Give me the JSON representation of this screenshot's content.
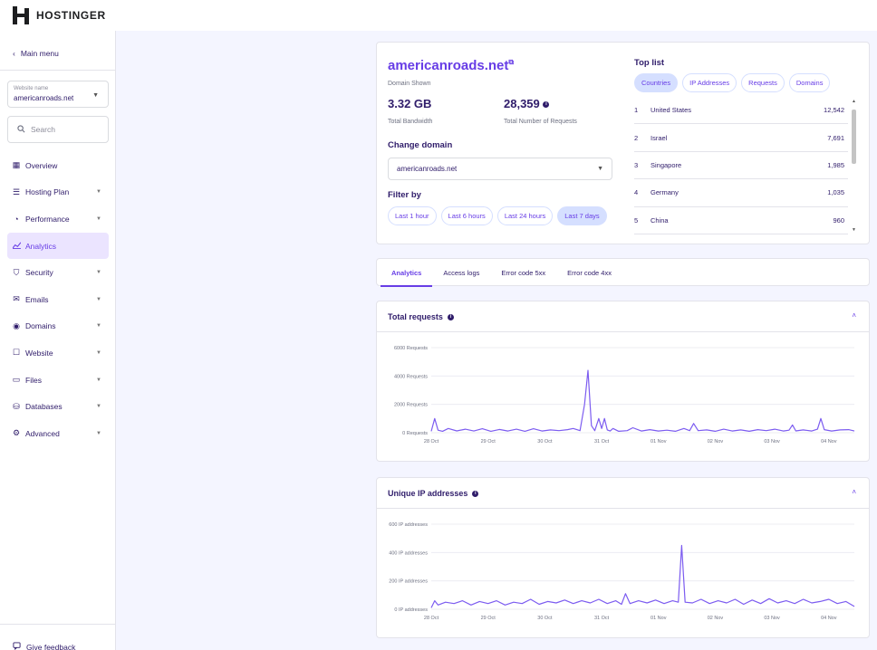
{
  "brand": {
    "name": "HOSTINGER"
  },
  "sidebar": {
    "back_label": "Main menu",
    "website_label": "Website name",
    "website_value": "americanroads.net",
    "search_placeholder": "Search",
    "items": [
      {
        "label": "Overview",
        "icon": "grid-icon",
        "expandable": false
      },
      {
        "label": "Hosting Plan",
        "icon": "server-icon",
        "expandable": true
      },
      {
        "label": "Performance",
        "icon": "gauge-icon",
        "expandable": true
      },
      {
        "label": "Analytics",
        "icon": "chart-line-icon",
        "expandable": false,
        "active": true
      },
      {
        "label": "Security",
        "icon": "shield-icon",
        "expandable": true
      },
      {
        "label": "Emails",
        "icon": "mail-icon",
        "expandable": true
      },
      {
        "label": "Domains",
        "icon": "globe-icon",
        "expandable": true
      },
      {
        "label": "Website",
        "icon": "browser-icon",
        "expandable": true
      },
      {
        "label": "Files",
        "icon": "folder-icon",
        "expandable": true
      },
      {
        "label": "Databases",
        "icon": "database-icon",
        "expandable": true
      },
      {
        "label": "Advanced",
        "icon": "gear-icon",
        "expandable": true
      }
    ],
    "feedback_label": "Give feedback"
  },
  "domain_card": {
    "domain": "americanroads.net",
    "domain_caption": "Domain Shown",
    "bandwidth": "3.32 GB",
    "bandwidth_label": "Total Bandwidth",
    "requests": "28,359",
    "requests_label": "Total Number of Requests",
    "change_domain_label": "Change domain",
    "change_domain_value": "americanroads.net",
    "filter_label": "Filter by",
    "filters": [
      "Last 1 hour",
      "Last 6 hours",
      "Last 24 hours",
      "Last 7 days"
    ],
    "active_filter": 3
  },
  "top_list": {
    "title": "Top list",
    "tabs": [
      "Countries",
      "IP Addresses",
      "Requests",
      "Domains"
    ],
    "active_tab": 0,
    "rows": [
      {
        "rank": "1",
        "name": "United States",
        "count": "12,542"
      },
      {
        "rank": "2",
        "name": "Israel",
        "count": "7,691"
      },
      {
        "rank": "3",
        "name": "Singapore",
        "count": "1,985"
      },
      {
        "rank": "4",
        "name": "Germany",
        "count": "1,035"
      },
      {
        "rank": "5",
        "name": "China",
        "count": "960"
      }
    ]
  },
  "analytics_tabs": {
    "tabs": [
      "Analytics",
      "Access logs",
      "Error code 5xx",
      "Error code 4xx"
    ],
    "active": 0
  },
  "colors": {
    "accent": "#673de6",
    "accent_light": "#d5dfff",
    "text": "#2f1c6a",
    "line": "#7c5cf0"
  },
  "charts": {
    "requests": {
      "title": "Total requests",
      "chart_data": {
        "type": "line",
        "ytick_labels": [
          "6000 Requests",
          "4000 Requests",
          "2000 Requests",
          "0 Requests"
        ],
        "yticks": [
          6000,
          4000,
          2000,
          0
        ],
        "ylim": [
          0,
          6000
        ],
        "xtick_labels": [
          "28 Oct",
          "29 Oct",
          "30 Oct",
          "31 Oct",
          "01 Nov",
          "02 Nov",
          "03 Nov",
          "04 Nov"
        ],
        "xlim": [
          0,
          7.45
        ],
        "series": [
          {
            "x": [
              0,
              0.06,
              0.12,
              0.2,
              0.3,
              0.45,
              0.6,
              0.75,
              0.9,
              1.05,
              1.2,
              1.35,
              1.5,
              1.65,
              1.8,
              1.95,
              2.1,
              2.25,
              2.4,
              2.5,
              2.62,
              2.7,
              2.76,
              2.82,
              2.88,
              2.95,
              3.0,
              3.05,
              3.1,
              3.15,
              3.2,
              3.3,
              3.45,
              3.55,
              3.7,
              3.85,
              4.0,
              4.15,
              4.3,
              4.45,
              4.55,
              4.62,
              4.7,
              4.85,
              5.0,
              5.15,
              5.3,
              5.45,
              5.6,
              5.75,
              5.9,
              6.05,
              6.2,
              6.3,
              6.36,
              6.42,
              6.55,
              6.7,
              6.8,
              6.86,
              6.92,
              7.05,
              7.2,
              7.35,
              7.45
            ],
            "y": [
              100,
              1000,
              180,
              100,
              300,
              130,
              250,
              120,
              280,
              100,
              230,
              120,
              250,
              100,
              280,
              120,
              200,
              150,
              220,
              300,
              150,
              2000,
              4400,
              500,
              150,
              1000,
              300,
              1000,
              200,
              120,
              300,
              100,
              150,
              350,
              120,
              220,
              120,
              180,
              100,
              300,
              150,
              650,
              150,
              200,
              100,
              250,
              120,
              200,
              100,
              220,
              150,
              250,
              120,
              180,
              550,
              130,
              200,
              120,
              250,
              1000,
              220,
              120,
              200,
              220,
              120
            ]
          }
        ]
      }
    },
    "ips": {
      "title": "Unique IP addresses",
      "chart_data": {
        "type": "line",
        "ytick_labels": [
          "600 IP addresses",
          "400 IP addresses",
          "200 IP addresses",
          "0 IP addresses"
        ],
        "yticks": [
          600,
          400,
          200,
          0
        ],
        "ylim": [
          0,
          600
        ],
        "xtick_labels": [
          "28 Oct",
          "29 Oct",
          "30 Oct",
          "31 Oct",
          "01 Nov",
          "02 Nov",
          "03 Nov",
          "04 Nov"
        ],
        "xlim": [
          0,
          7.45
        ],
        "series": [
          {
            "x": [
              0,
              0.06,
              0.12,
              0.25,
              0.4,
              0.55,
              0.7,
              0.85,
              1.0,
              1.15,
              1.3,
              1.45,
              1.6,
              1.75,
              1.9,
              2.05,
              2.2,
              2.35,
              2.5,
              2.65,
              2.8,
              2.95,
              3.1,
              3.25,
              3.35,
              3.42,
              3.5,
              3.65,
              3.8,
              3.95,
              4.1,
              4.25,
              4.35,
              4.41,
              4.47,
              4.6,
              4.75,
              4.9,
              5.05,
              5.2,
              5.35,
              5.5,
              5.65,
              5.8,
              5.95,
              6.1,
              6.25,
              6.4,
              6.55,
              6.7,
              6.85,
              7.0,
              7.15,
              7.3,
              7.45
            ],
            "y": [
              10,
              60,
              30,
              50,
              40,
              60,
              30,
              55,
              40,
              60,
              30,
              50,
              40,
              70,
              35,
              55,
              45,
              65,
              40,
              60,
              45,
              70,
              40,
              60,
              35,
              110,
              40,
              60,
              45,
              65,
              40,
              60,
              50,
              450,
              50,
              45,
              70,
              40,
              60,
              45,
              70,
              35,
              65,
              40,
              75,
              45,
              60,
              40,
              70,
              45,
              55,
              70,
              40,
              55,
              20
            ]
          }
        ]
      }
    }
  }
}
